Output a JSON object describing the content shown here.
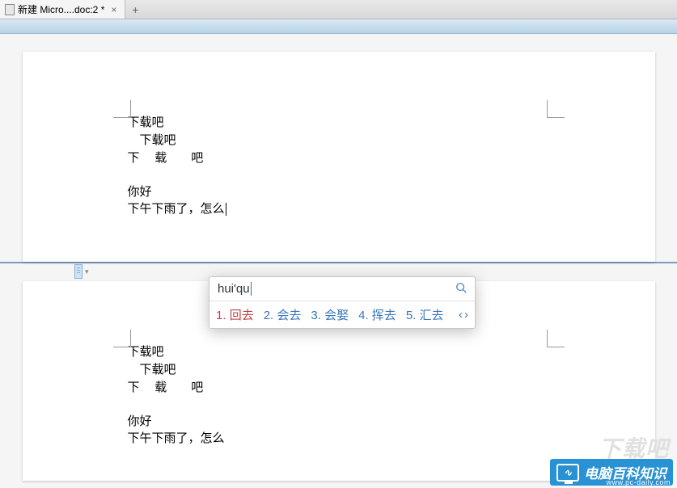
{
  "tab": {
    "title": "新建 Micro....doc:2 *",
    "close": "×",
    "new": "+"
  },
  "document": {
    "lines": {
      "l1": "下载吧",
      "l2": "下载吧",
      "l3": "下 载  吧",
      "l4": "你好",
      "l5": "下午下雨了，怎么"
    }
  },
  "ime": {
    "input": "hui'qu",
    "candidates": [
      {
        "num": "1.",
        "word": "回去"
      },
      {
        "num": "2.",
        "word": "会去"
      },
      {
        "num": "3.",
        "word": "会娶"
      },
      {
        "num": "4.",
        "word": "挥去"
      },
      {
        "num": "5.",
        "word": "汇去"
      }
    ],
    "nav_prev": "‹",
    "nav_next": "›"
  },
  "watermark": {
    "shadow": "下载吧",
    "brand": "电脑百科知识",
    "url": "www.pc-daily.com"
  }
}
